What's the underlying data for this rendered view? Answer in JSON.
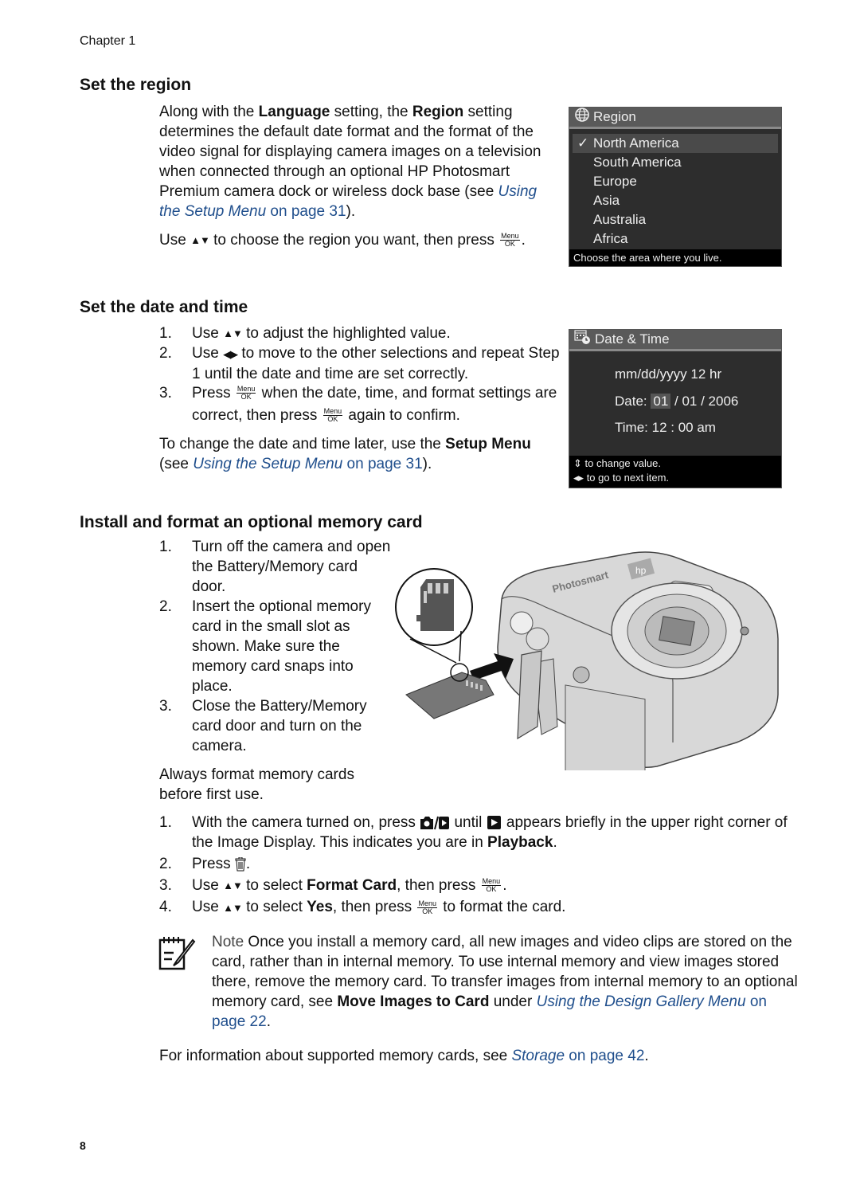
{
  "header": {
    "chapter": "Chapter 1"
  },
  "region_section": {
    "title": "Set the region",
    "para1": {
      "t1": "Along with the ",
      "b1": "Language",
      "t2": " setting, the ",
      "b2": "Region",
      "t3": " setting determines the default date format and the format of the video signal for displaying camera images on a television when connected through an optional HP Photosmart Premium camera dock or wireless dock base (see ",
      "link_italic": "Using the Setup Menu",
      "link_rest": " on page 31",
      "t4": ")."
    },
    "para2": {
      "t1": "Use ",
      "t2": " to choose the region you want, then press ",
      "t3": "."
    },
    "screen": {
      "title": "Region",
      "items": [
        "North America",
        "South America",
        "Europe",
        "Asia",
        "Australia",
        "Africa"
      ],
      "selected_index": 0,
      "footer": "Choose the area where you live."
    }
  },
  "date_section": {
    "title": "Set the date and time",
    "steps": [
      {
        "num": "1.",
        "t1": "Use ",
        "t2": " to adjust the highlighted value."
      },
      {
        "num": "2.",
        "t1": "Use ",
        "t2": " to move to the other selections and repeat Step 1 until the date and time are set correctly."
      },
      {
        "num": "3.",
        "t1": "Press ",
        "t2": " when the date, time, and format settings are correct, then press ",
        "t3": " again to confirm."
      }
    ],
    "para": {
      "t1": "To change the date and time later, use the ",
      "b1": "Setup Menu",
      "t2": " (see ",
      "link_italic": "Using the Setup Menu",
      "link_rest": " on page 31",
      "t3": ")."
    },
    "screen": {
      "title": "Date & Time",
      "format": "mm/dd/yyyy  12 hr",
      "date_label": "Date:",
      "date_month": "01",
      "date_rest": "/ 01 / 2006",
      "time_label": "Time:",
      "time_value": "12 : 00  am",
      "footer1": "to change value.",
      "footer2": "to go to next item."
    }
  },
  "card_section": {
    "title": "Install and format an optional memory card",
    "steps": [
      {
        "num": "1.",
        "text": "Turn off the camera and open the Battery/Memory card door."
      },
      {
        "num": "2.",
        "text": "Insert the optional memory card in the small slot as shown. Make sure the memory card snaps into place."
      },
      {
        "num": "3.",
        "text": "Close the Battery/Memory card door and turn on the camera."
      }
    ],
    "always_text": "Always format memory cards before first use.",
    "illustration": {
      "brand": "Photosmart",
      "logo": "hp"
    },
    "format_steps": [
      {
        "num": "1.",
        "t1": "With the camera turned on, press ",
        "t2": " until ",
        "t3": " appears briefly in the upper right corner of the Image Display. This indicates you are in ",
        "b1": "Playback",
        "t4": "."
      },
      {
        "num": "2.",
        "t1": "Press ",
        "t2": "."
      },
      {
        "num": "3.",
        "t1": "Use ",
        "t2": " to select ",
        "b1": "Format Card",
        "t3": ", then press ",
        "t4": "."
      },
      {
        "num": "4.",
        "t1": "Use ",
        "t2": " to select ",
        "b1": "Yes",
        "t3": ", then press ",
        "t4": " to format the card."
      }
    ],
    "note": {
      "label": "Note",
      "t1": "  Once you install a memory card, all new images and video clips are stored on the card, rather than in internal memory. To use internal memory and view images stored there, remove the memory card. To transfer images from internal memory to an optional memory card, see ",
      "b1": "Move Images to Card",
      "t2": " under ",
      "link_italic": "Using the Design Gallery Menu",
      "link_rest": " on page 22",
      "t3": "."
    },
    "storage": {
      "t1": "For information about supported memory cards, see ",
      "link_italic": "Storage",
      "link_rest": " on page 42",
      "t2": "."
    }
  },
  "buttons": {
    "menu_top": "Menu",
    "menu_bottom": "OK",
    "updown": "▲▼",
    "leftright": "◀▶"
  },
  "colors": {
    "link": "#1f4e8c",
    "screen_bg": "#2d2d2d",
    "screen_title": "#5a5a5a"
  },
  "footer": {
    "page_number": "8"
  }
}
